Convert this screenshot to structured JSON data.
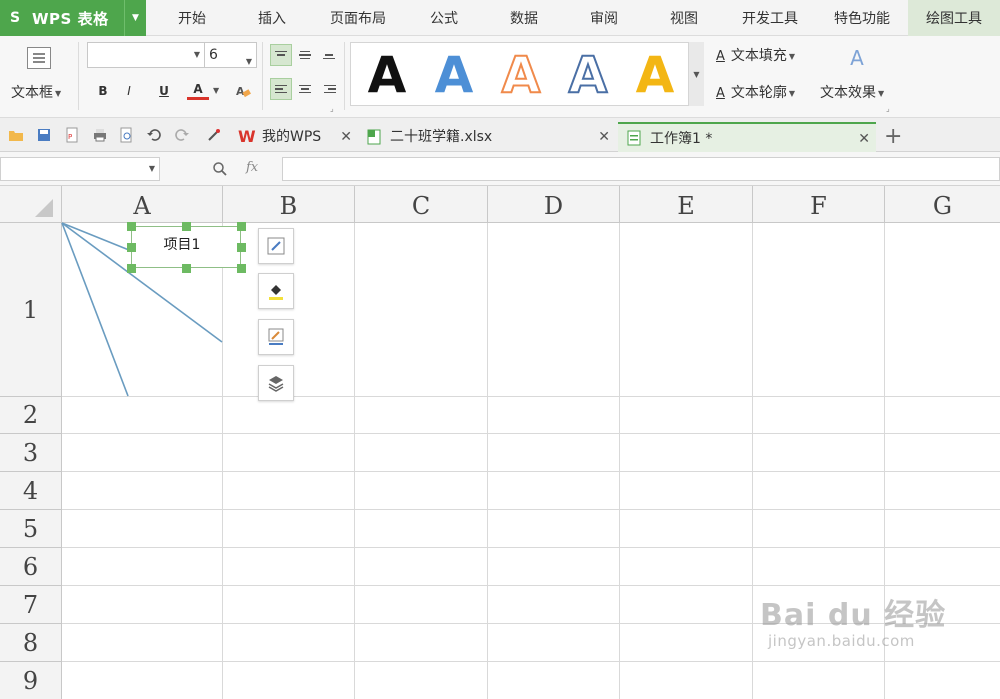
{
  "app": {
    "name": "WPS 表格",
    "logo": "S"
  },
  "menu": {
    "tabs": [
      "开始",
      "插入",
      "页面布局",
      "公式",
      "数据",
      "审阅",
      "视图",
      "开发工具",
      "特色功能",
      "绘图工具"
    ],
    "active_index": 9
  },
  "ribbon": {
    "textbox_label": "文本框",
    "font_name": "",
    "font_size": "6",
    "bold": "B",
    "italic": "I",
    "underline": "U",
    "font_color_glyph": "A",
    "wordart_glyph": "A",
    "text_fill": "文本填充",
    "text_outline": "文本轮廓",
    "text_effect": "文本效果",
    "font_color": "#d9342b"
  },
  "doc_tabs": [
    {
      "label": "我的WPS",
      "icon": "wps-logo-icon"
    },
    {
      "label": "二十班学籍.xlsx",
      "icon": "excel-file-icon"
    },
    {
      "label": "工作簿1 *",
      "icon": "sheet-file-icon",
      "active": true
    }
  ],
  "formula_bar": {
    "fx_label": "fx",
    "name_box": "",
    "formula": ""
  },
  "sheet": {
    "columns": [
      "A",
      "B",
      "C",
      "D",
      "E",
      "F",
      "G"
    ],
    "rows": [
      "1",
      "2",
      "3",
      "4",
      "5",
      "6",
      "7",
      "8",
      "9"
    ],
    "textbox_text": "项目1"
  },
  "watermark": {
    "brand": "Bai du 经验",
    "url": "jingyan.baidu.com"
  },
  "colors": {
    "accent_green": "#4ea64c",
    "active_tab_bg": "#dde9d8",
    "diagonal_line": "#6a9cc0"
  }
}
